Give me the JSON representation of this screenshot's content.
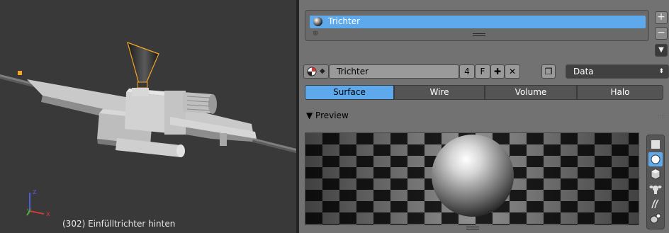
{
  "viewport": {
    "status_text": "(302) Einfülltrichter hinten",
    "axes": {
      "x": "x",
      "y": "y",
      "z": "z"
    }
  },
  "material_slots": {
    "items": [
      {
        "label": "Trichter",
        "selected": true
      }
    ],
    "icons": [
      "material-sphere-icon",
      "plus-icon",
      "minus-icon",
      "dropdown-icon"
    ]
  },
  "material_datablock": {
    "name": "Trichter",
    "users": "4",
    "fake_user": "F",
    "link": "Data"
  },
  "tabs": [
    {
      "label": "Surface",
      "active": true
    },
    {
      "label": "Wire",
      "active": false
    },
    {
      "label": "Volume",
      "active": false
    },
    {
      "label": "Halo",
      "active": false
    }
  ],
  "preview": {
    "header": "▼ Preview",
    "shapes": [
      "flat-icon",
      "sphere-icon",
      "cube-icon",
      "monkey-icon",
      "hair-icon",
      "world-sphere-icon"
    ],
    "active_shape": "sphere-icon"
  },
  "colors": {
    "accent": "#5ea9ec",
    "panel": "#727272",
    "viewport": "#393939",
    "selection_outline": "#f5a623"
  }
}
